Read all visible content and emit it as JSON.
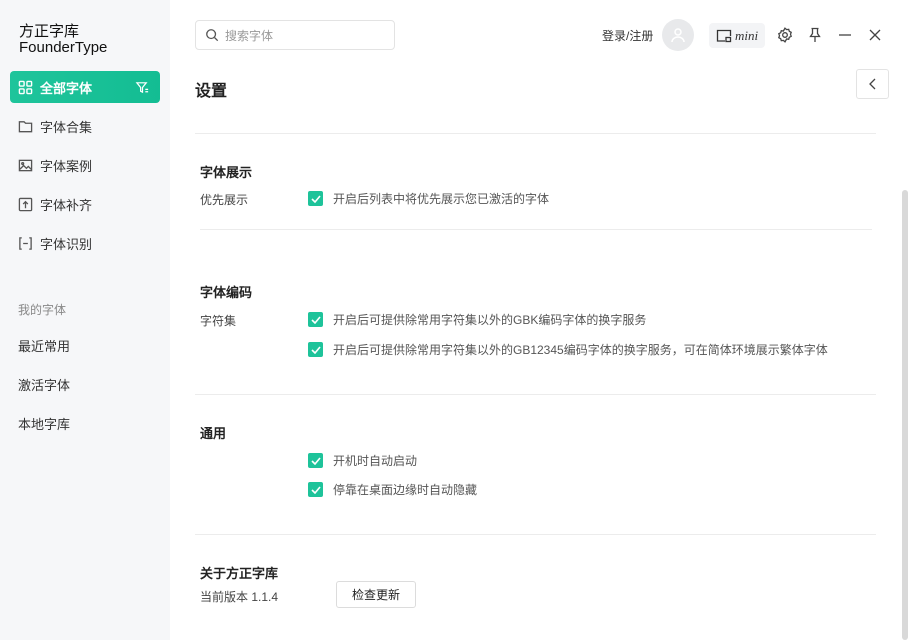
{
  "app": {
    "logo_cn": "方正字库",
    "logo_en": "FounderType"
  },
  "sidebar": {
    "items": [
      {
        "label": "全部字体"
      },
      {
        "label": "字体合集"
      },
      {
        "label": "字体案例"
      },
      {
        "label": "字体补齐"
      },
      {
        "label": "字体识别"
      }
    ],
    "my_fonts_title": "我的字体",
    "my_fonts": [
      {
        "label": "最近常用"
      },
      {
        "label": "激活字体"
      },
      {
        "label": "本地字库"
      }
    ]
  },
  "header": {
    "search_placeholder": "搜索字体",
    "login": "登录/注册",
    "mini": "mini"
  },
  "page": {
    "title": "设置"
  },
  "settings": {
    "display": {
      "title": "字体展示",
      "label": "优先展示",
      "option": "开启后列表中将优先展示您已激活的字体"
    },
    "encoding": {
      "title": "字体编码",
      "label": "字符集",
      "options": [
        "开启后可提供除常用字符集以外的GBK编码字体的换字服务",
        "开启后可提供除常用字符集以外的GB12345编码字体的换字服务，可在简体环境展示繁体字体"
      ]
    },
    "general": {
      "title": "通用",
      "options": [
        "开机时自动启动",
        "停靠在桌面边缘时自动隐藏"
      ]
    },
    "about": {
      "title": "关于方正字库",
      "version": "当前版本 1.1.4",
      "check_update": "检查更新"
    }
  },
  "colors": {
    "accent": "#1ec39a"
  }
}
